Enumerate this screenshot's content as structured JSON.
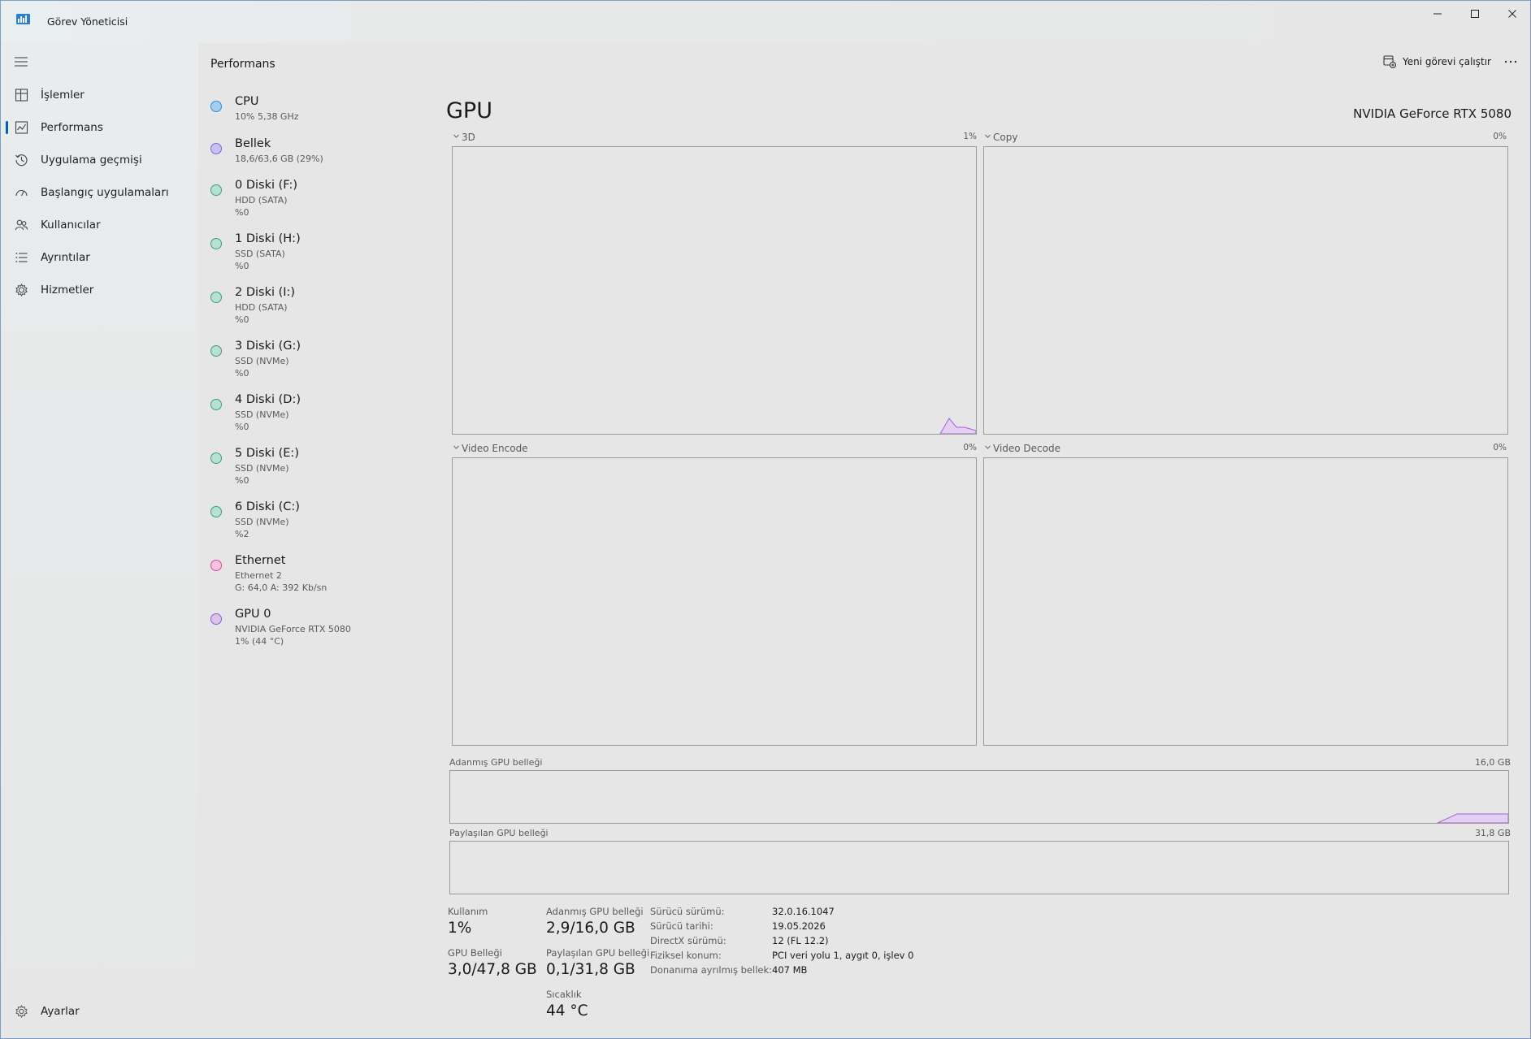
{
  "window": {
    "title": "Görev Yöneticisi"
  },
  "nav": {
    "items": [
      {
        "label": "İşlemler",
        "icon": "processes-icon"
      },
      {
        "label": "Performans",
        "icon": "performance-icon"
      },
      {
        "label": "Uygulama geçmişi",
        "icon": "history-icon"
      },
      {
        "label": "Başlangıç uygulamaları",
        "icon": "startup-icon"
      },
      {
        "label": "Kullanıcılar",
        "icon": "users-icon"
      },
      {
        "label": "Ayrıntılar",
        "icon": "details-icon"
      },
      {
        "label": "Hizmetler",
        "icon": "services-icon"
      }
    ],
    "settings_label": "Ayarlar"
  },
  "header": {
    "page_title": "Performans",
    "run_task_label": "Yeni görevi çalıştır",
    "more_label": "⋯"
  },
  "devices": [
    {
      "name": "CPU",
      "lines": [
        "10%  5,38 GHz"
      ],
      "color": "#2e8bd6"
    },
    {
      "name": "Bellek",
      "lines": [
        "18,6/63,6 GB (29%)"
      ],
      "color": "#7b68d9"
    },
    {
      "name": "0 Diski (F:)",
      "lines": [
        "HDD (SATA)",
        "%0"
      ],
      "color": "#3a9f7f"
    },
    {
      "name": "1 Diski (H:)",
      "lines": [
        "SSD (SATA)",
        "%0"
      ],
      "color": "#3a9f7f"
    },
    {
      "name": "2 Diski (I:)",
      "lines": [
        "HDD (SATA)",
        "%0"
      ],
      "color": "#3a9f7f"
    },
    {
      "name": "3 Diski (G:)",
      "lines": [
        "SSD (NVMe)",
        "%0"
      ],
      "color": "#3a9f7f"
    },
    {
      "name": "4 Diski (D:)",
      "lines": [
        "SSD (NVMe)",
        "%0"
      ],
      "color": "#3a9f7f"
    },
    {
      "name": "5 Diski (E:)",
      "lines": [
        "SSD (NVMe)",
        "%0"
      ],
      "color": "#3a9f7f"
    },
    {
      "name": "6 Diski (C:)",
      "lines": [
        "SSD (NVMe)",
        "%2"
      ],
      "color": "#3a9f7f"
    },
    {
      "name": "Ethernet",
      "lines": [
        "Ethernet 2",
        "G: 64,0  A: 392 Kb/sn"
      ],
      "color": "#d9479a"
    },
    {
      "name": "GPU 0",
      "lines": [
        "NVIDIA GeForce RTX 5080",
        "1% (44 °C)"
      ],
      "color": "#8b5bc9"
    }
  ],
  "gpu": {
    "title": "GPU",
    "model": "NVIDIA GeForce RTX 5080",
    "engines": [
      {
        "name": "3D",
        "percent": "1%"
      },
      {
        "name": "Copy",
        "percent": "0%"
      },
      {
        "name": "Video Encode",
        "percent": "0%"
      },
      {
        "name": "Video Decode",
        "percent": "0%"
      }
    ],
    "dedicated_mem": {
      "label": "Adanmış GPU belleği",
      "max": "16,0 GB"
    },
    "shared_mem": {
      "label": "Paylaşılan GPU belleği",
      "max": "31,8 GB"
    },
    "stats": {
      "usage_label": "Kullanım",
      "usage_value": "1%",
      "gpu_mem_label": "GPU Belleği",
      "gpu_mem_value": "3,0/47,8 GB",
      "dedicated_label": "Adanmış GPU belleği",
      "dedicated_value": "2,9/16,0 GB",
      "shared_label": "Paylaşılan GPU belleği",
      "shared_value": "0,1/31,8 GB",
      "temp_label": "Sıcaklık",
      "temp_value": "44 °C"
    },
    "info": [
      {
        "key": "Sürücü sürümü:",
        "value": "32.0.16.1047"
      },
      {
        "key": "Sürücü tarihi:",
        "value": "19.05.2026"
      },
      {
        "key": "DirectX sürümü:",
        "value": "12 (FL 12.2)"
      },
      {
        "key": "Fiziksel konum:",
        "value": "PCI veri yolu 1, aygıt 0, işlev 0"
      },
      {
        "key": "Donanıma ayrılmış bellek:",
        "value": "407 MB"
      }
    ]
  },
  "colors": {
    "accent": "#005fb8",
    "gpu_graph": "#a65fd8",
    "graph_border": "#9b9b9b"
  }
}
